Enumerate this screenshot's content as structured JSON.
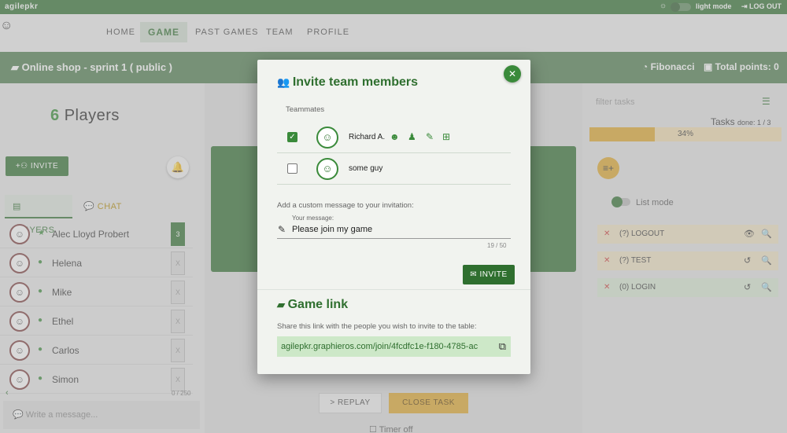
{
  "topbar": {
    "logo": "agilepkr",
    "mode_icon": "☼",
    "mode_label": "light mode",
    "logout": "LOG OUT"
  },
  "nav": {
    "items": [
      "HOME",
      "GAME",
      "PAST GAMES",
      "TEAM",
      "PROFILE"
    ],
    "active": "GAME"
  },
  "game": {
    "title": "Online shop - sprint 1 ( public )",
    "deck": "Fibonacci",
    "total": "Total points: 0"
  },
  "left": {
    "players_count": "6",
    "players_word": "Players",
    "invite_label": "INVITE",
    "tabs": {
      "players": "PLAYERS",
      "chat": "CHAT"
    },
    "players": [
      {
        "name": "Alec Lloyd Probert",
        "status": "★",
        "card": "3",
        "voted": true
      },
      {
        "name": "Helena",
        "status": "●",
        "card": "X",
        "voted": false
      },
      {
        "name": "Mike",
        "status": "●",
        "card": "X",
        "voted": false
      },
      {
        "name": "Ethel",
        "status": "●",
        "card": "X",
        "voted": false
      },
      {
        "name": "Carlos",
        "status": "●",
        "card": "X",
        "voted": false
      },
      {
        "name": "Simon",
        "status": "●",
        "card": "X",
        "voted": false
      }
    ],
    "chat_counter": "0 / 250",
    "chat_placeholder": "Write a message..."
  },
  "center": {
    "replay": "REPLAY",
    "close_task": "CLOSE TASK",
    "timer": "Timer off"
  },
  "right": {
    "filter_placeholder": "filter tasks",
    "tasks_title": "Tasks",
    "tasks_done": "done: 1 / 3",
    "progress": 0.34,
    "progress_label": "34%",
    "list_mode": "List mode",
    "tasks": [
      {
        "label": "(?) LOGOUT",
        "icon": "👁",
        "color": "#f1e3c4"
      },
      {
        "label": "(?) TEST",
        "icon": "↺",
        "color": "#f1e3c4"
      },
      {
        "label": "(0) LOGIN",
        "icon": "↺",
        "color": "#d9ead4"
      }
    ]
  },
  "modal": {
    "title": "Invite team members",
    "teammates_label": "Teammates",
    "teammates": [
      {
        "name": "Richard A.",
        "checked": true
      },
      {
        "name": "some guy",
        "checked": false
      }
    ],
    "custom_msg_label": "Add a custom message to your invitation:",
    "msg_field_label": "Your message:",
    "msg_value": "Please join my game",
    "msg_counter": "19 / 50",
    "invite_btn": "INVITE",
    "link_title": "Game link",
    "link_desc": "Share this link with the people you wish to invite to the table:",
    "link_url": "agilepkr.graphieros.com/join/4fcdfc1e-f180-4785-ac"
  },
  "colors": {
    "primary": "#2f6f2f",
    "accent": "#e0a82a"
  }
}
